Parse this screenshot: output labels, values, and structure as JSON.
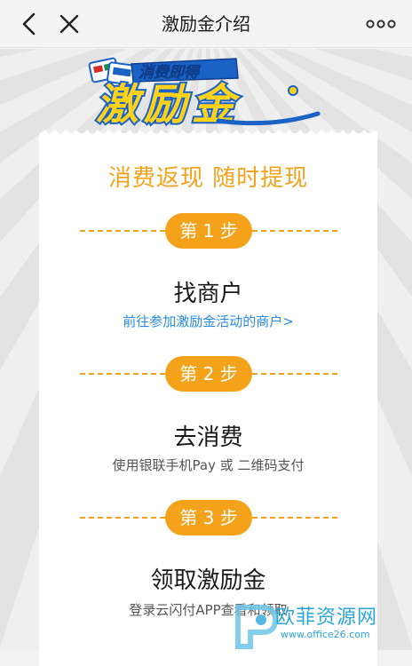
{
  "topbar": {
    "title": "激励金介绍",
    "icons": [
      "back-arrow-icon",
      "close-icon",
      "more-dots-icon"
    ]
  },
  "banner": {
    "small_text": "消费即得",
    "big_text": "激励金"
  },
  "slogan": "消费返现 随时提现",
  "steps": [
    {
      "badge": "第 1 步",
      "title": "找商户",
      "desc": "前往参加激励金活动的商户>"
    },
    {
      "badge": "第 2 步",
      "title": "去消费",
      "desc": "使用银联手机Pay 或 二维码支付"
    },
    {
      "badge": "第 3 步",
      "title": "领取激励金",
      "desc": "登录云闪付APP查看和领取"
    }
  ],
  "watermark": {
    "text": "欧菲资源网",
    "sub": "www.office26.com"
  },
  "colors": {
    "accent": "#f5a21b",
    "link": "#2b8ce3",
    "banner_blue": "#1b62c7",
    "banner_yellow": "#ffd21a"
  }
}
